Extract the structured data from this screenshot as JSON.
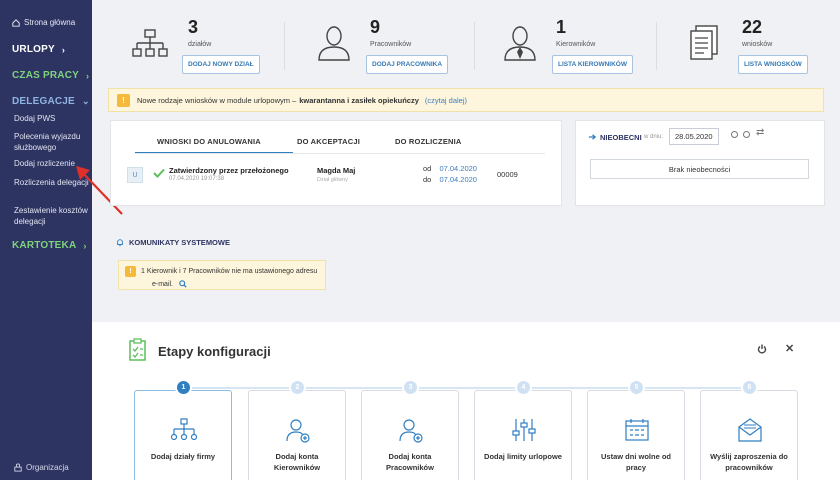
{
  "sidebar": {
    "home": "Strona główna",
    "urlopy": "URLOPY",
    "czas_pracy": "CZAS PRACY",
    "delegacje": "DELEGACJE",
    "items": [
      "Dodaj PWS",
      "Polecenia wyjazdu służbowego",
      "Dodaj rozliczenie",
      "Rozliczenia delegacji",
      "Zestawienie kosztów delegacji"
    ],
    "kartoteka": "KARTOTEKA",
    "organizacja": "Organizacja"
  },
  "stats": [
    {
      "value": "3",
      "label": "działów",
      "button": "DODAJ NOWY DZIAŁ",
      "icon": "org-chart-icon"
    },
    {
      "value": "9",
      "label": "Pracowników",
      "button": "DODAJ PRACOWNIKA",
      "icon": "employee-icon"
    },
    {
      "value": "1",
      "label": "Kierowników",
      "button": "LISTA KIEROWNIKÓW",
      "icon": "manager-icon"
    },
    {
      "value": "22",
      "label": "wniosków",
      "button": "LISTA WNIOSKÓW",
      "icon": "documents-icon"
    }
  ],
  "notice": {
    "prefix": "Nowe rodzaje wniosków w module urlopowym –",
    "bold": "kwarantanna i zasiłek opiekuńczy",
    "link": "(czytaj dalej)"
  },
  "requests": {
    "tabs": [
      "WNIOSKI DO ANULOWANIA",
      "DO AKCEPTACJI",
      "DO ROZLICZENIA"
    ],
    "row": {
      "badge": "U",
      "status": "Zatwierdzony przez przełożonego",
      "timestamp": "07.04.2020 19:07:38",
      "name": "Magda Maj",
      "dept": "Dział główny",
      "from_label": "od",
      "from": "07.04.2020",
      "to_label": "do",
      "to": "07.04.2020",
      "number": "00009"
    }
  },
  "absent": {
    "title": "NIEOBECNI",
    "day_label": "w dniu:",
    "date": "28.05.2020",
    "empty": "Brak nieobecności"
  },
  "system": {
    "title": "KOMUNIKATY SYSTEMOWE",
    "message_line1": "1 Kierownik i 7 Pracowników nie ma ustawionego adresu",
    "message_line2": "e-mail."
  },
  "config": {
    "title": "Etapy konfiguracji",
    "steps": [
      {
        "num": "1",
        "label": "Dodaj działy firmy"
      },
      {
        "num": "2",
        "label": "Dodaj konta Kierowników"
      },
      {
        "num": "3",
        "label": "Dodaj konta Pracowników"
      },
      {
        "num": "4",
        "label": "Dodaj limity urlopowe"
      },
      {
        "num": "5",
        "label": "Ustaw dni wolne od pracy"
      },
      {
        "num": "6",
        "label": "Wyślij zaproszenia do pracowników"
      }
    ]
  },
  "colors": {
    "sidebar": "#2e3462",
    "accent": "#2f7fc3",
    "green": "#7ed37d",
    "warning": "#f5b93c",
    "arrow": "#e0302a"
  }
}
